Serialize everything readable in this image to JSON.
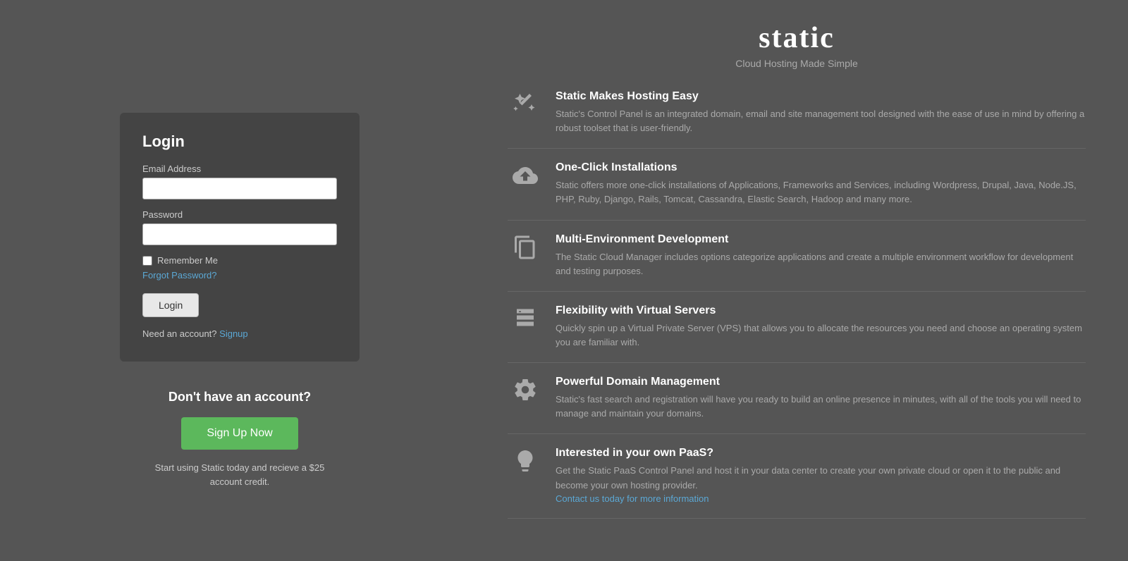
{
  "brand": {
    "name": "static",
    "tagline": "Cloud Hosting Made Simple"
  },
  "login": {
    "title": "Login",
    "email_label": "Email Address",
    "email_placeholder": "",
    "password_label": "Password",
    "password_placeholder": "",
    "remember_label": "Remember Me",
    "forgot_label": "Forgot Password?",
    "button_label": "Login",
    "need_account_text": "Need an account?",
    "signup_link_label": "Signup"
  },
  "signup": {
    "heading": "Don't have an account?",
    "button_label": "Sign Up Now",
    "credit_text": "Start using Static today and recieve a $25\naccount credit."
  },
  "features": [
    {
      "id": "easy",
      "title": "Static Makes Hosting Easy",
      "desc": "Static's Control Panel is an integrated domain, email and site management tool designed with the ease of use in mind by offering a robust toolset that is user-friendly.",
      "icon": "wand"
    },
    {
      "id": "oneclick",
      "title": "One-Click Installations",
      "desc": "Static offers more one-click installations of Applications, Frameworks and Services, including Wordpress, Drupal, Java, Node.JS, PHP, Ruby, Django, Rails, Tomcat, Cassandra, Elastic Search, Hadoop and many more.",
      "icon": "cloud-upload"
    },
    {
      "id": "multi-env",
      "title": "Multi-Environment Development",
      "desc": "The Static Cloud Manager includes options categorize applications and create a multiple environment workflow for development and testing purposes.",
      "icon": "files"
    },
    {
      "id": "vps",
      "title": "Flexibility with Virtual Servers",
      "desc": "Quickly spin up a Virtual Private Server (VPS) that allows you to allocate the resources you need and choose an operating system you are familiar with.",
      "icon": "server"
    },
    {
      "id": "domain",
      "title": "Powerful Domain Management",
      "desc": "Static's fast search and registration will have you ready to build an online presence in minutes, with all of the tools you will need to manage and maintain your domains.",
      "icon": "gear"
    },
    {
      "id": "paas",
      "title": "Interested in your own PaaS?",
      "desc": "Get the Static PaaS Control Panel and host it in your data center to create your own private cloud or open it to the public and become your own hosting provider.",
      "icon": "bulb",
      "link": "Contact us today for more information"
    }
  ]
}
